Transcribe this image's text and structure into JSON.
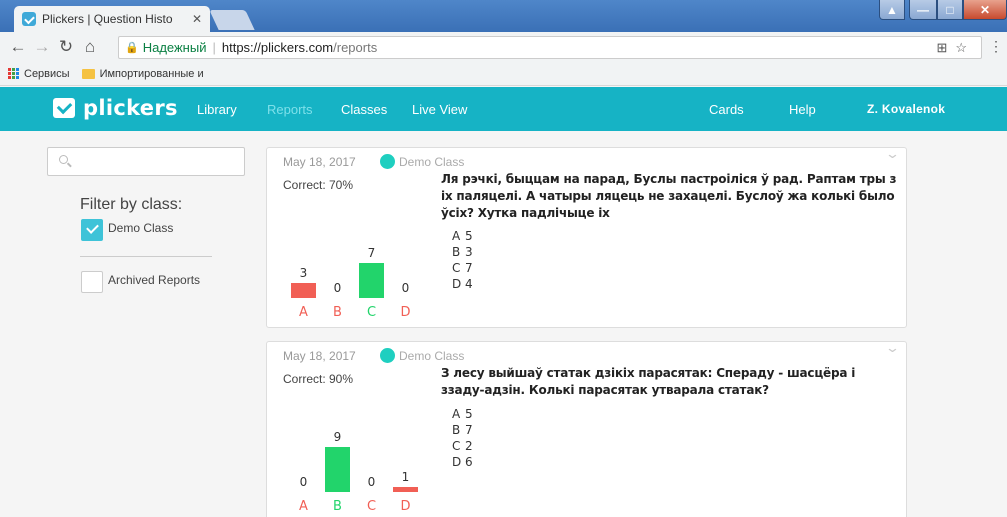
{
  "browser": {
    "tab_title": "Plickers | Question Histo",
    "secure_label": "Надежный",
    "url_host": "https://plickers.com",
    "url_path": "/reports",
    "bookmarks": [
      "Сервисы",
      "Импортированные и"
    ]
  },
  "nav": {
    "logo": "plickers",
    "links": [
      "Library",
      "Reports",
      "Classes",
      "Live View"
    ],
    "active": "Reports",
    "right_links": [
      "Cards",
      "Help"
    ],
    "user": "Z. Kovalenok"
  },
  "sidebar": {
    "search_placeholder": "",
    "filter_title": "Filter by class:",
    "class_label": "Demo Class",
    "archived_label": "Archived Reports"
  },
  "reports": [
    {
      "date": "May 18, 2017",
      "class": "Demo Class",
      "correct": "Correct: 70%",
      "question": "Ля рэчкі, быццам на парад, Буслы пастроіліся ў рад. Раптам тры з іх паляцелі. А чатыры ляцець не захацелі. Буслоў жа колькі было ўсіх? Хутка падлічыце іх",
      "choices": [
        {
          "letter": "A",
          "text": "5"
        },
        {
          "letter": "B",
          "text": "3"
        },
        {
          "letter": "C",
          "text": "7"
        },
        {
          "letter": "D",
          "text": "4"
        }
      ],
      "responses": [
        3,
        0,
        7,
        0
      ],
      "correct_answer": "C"
    },
    {
      "date": "May 18, 2017",
      "class": "Demo Class",
      "correct": "Correct: 90%",
      "question": "З лесу выйшаў статак дзікіх парасятак: Спераду - шасцёра і ззаду-адзін. Колькі парасятак утварала статак?",
      "choices": [
        {
          "letter": "A",
          "text": "5"
        },
        {
          "letter": "B",
          "text": "7"
        },
        {
          "letter": "C",
          "text": "2"
        },
        {
          "letter": "D",
          "text": "6"
        }
      ],
      "responses": [
        0,
        9,
        0,
        1
      ],
      "correct_answer": "B"
    }
  ],
  "colors": {
    "brand": "#16b3c5",
    "correct": "#22d46b",
    "incorrect": "#f15f55",
    "class_dot": "#1fcfc0"
  }
}
